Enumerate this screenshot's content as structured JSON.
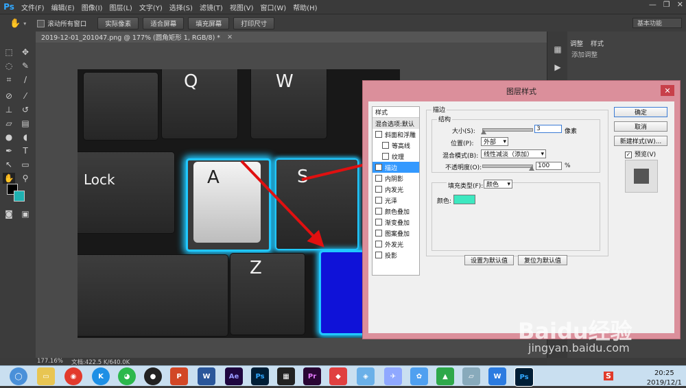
{
  "app": {
    "logo": "Ps"
  },
  "menu": [
    "文件(F)",
    "编辑(E)",
    "图像(I)",
    "图层(L)",
    "文字(Y)",
    "选择(S)",
    "滤镜(T)",
    "视图(V)",
    "窗口(W)",
    "帮助(H)"
  ],
  "window_controls": {
    "minimize": "—",
    "restore": "❐",
    "close": "✕"
  },
  "options_bar": {
    "scroll_all": "滚动所有窗口",
    "buttons": [
      "实际像素",
      "适合屏幕",
      "填充屏幕",
      "打印尺寸"
    ],
    "workspace": "基本功能"
  },
  "document": {
    "tab_title": "2019-12-01_201047.png @ 177% (圆角矩形 1, RGB/8) *",
    "zoom": "177.16%",
    "doc_info": "文档:422.5 K/640.0K"
  },
  "keys": {
    "q": "Q",
    "w": "W",
    "a": "A",
    "s": "S",
    "z": "Z",
    "lock": "Lock"
  },
  "right_panel": {
    "tab_adjust": "调整",
    "tab_style": "样式",
    "add_adjust": "添加调整"
  },
  "dialog": {
    "title": "图层样式",
    "close": "✕",
    "styles_header": "样式",
    "blend_default": "混合选项:默认",
    "style_items": [
      {
        "label": "斜面和浮雕",
        "checked": false
      },
      {
        "label": "等高线",
        "checked": false,
        "indent": true
      },
      {
        "label": "纹理",
        "checked": false,
        "indent": true
      },
      {
        "label": "描边",
        "checked": true,
        "selected": true
      },
      {
        "label": "内阴影",
        "checked": false
      },
      {
        "label": "内发光",
        "checked": false
      },
      {
        "label": "光泽",
        "checked": false
      },
      {
        "label": "颜色叠加",
        "checked": false
      },
      {
        "label": "渐变叠加",
        "checked": false
      },
      {
        "label": "图案叠加",
        "checked": false
      },
      {
        "label": "外发光",
        "checked": false
      },
      {
        "label": "投影",
        "checked": false
      }
    ],
    "section_title": "描边",
    "structure_title": "结构",
    "size_label": "大小(S):",
    "size_value": "3",
    "size_unit": "像素",
    "position_label": "位置(P):",
    "position_value": "外部",
    "blend_label": "混合模式(B):",
    "blend_value": "线性减淡（添加）",
    "opacity_label": "不透明度(O):",
    "opacity_value": "100",
    "opacity_unit": "%",
    "fill_type_label": "填充类型(F):",
    "fill_type_value": "颜色",
    "color_label": "颜色:",
    "stroke_color": "#3de8c0",
    "reset_default": "设置为默认值",
    "restore_default": "复位为默认值",
    "ok": "确定",
    "cancel": "取消",
    "new_style": "新建样式(W)...",
    "preview_label": "预览(V)",
    "preview_checked": true
  },
  "taskbar": {
    "time": "20:25",
    "date": "2019/12/1",
    "input_method": "S",
    "ps": "Ps",
    "ae": "Ae",
    "pr": "Pr",
    "word": "W"
  },
  "watermark": {
    "text": "Baidu经验",
    "url": "jingyan.baidu.com"
  },
  "colors": {
    "accent_blue": "#0f12d8",
    "glow": "#20c8ff",
    "arrow": "#e01010",
    "teal": "#1fb1b1"
  }
}
